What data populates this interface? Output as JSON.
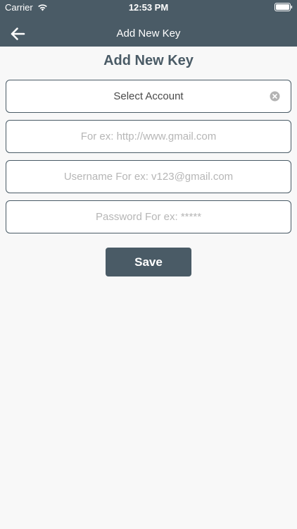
{
  "status_bar": {
    "carrier": "Carrier",
    "time": "12:53 PM",
    "wifi_icon": "wifi-icon",
    "battery_icon": "battery-full-icon"
  },
  "nav": {
    "back_icon": "arrow-left-icon",
    "title": "Add New Key"
  },
  "page": {
    "title": "Add New Key"
  },
  "form": {
    "account_select": {
      "value": "Select Account",
      "clear_icon": "clear-circle-icon"
    },
    "url": {
      "value": "",
      "placeholder": "For ex: http://www.gmail.com"
    },
    "username": {
      "value": "",
      "placeholder": "Username For ex: v123@gmail.com"
    },
    "password": {
      "value": "",
      "placeholder": "Password For ex: *****"
    },
    "save_label": "Save"
  },
  "colors": {
    "header_bg": "#4a5b66",
    "page_bg": "#f8f8f8",
    "accent": "#4a5b66",
    "placeholder": "#b6b6b6"
  }
}
